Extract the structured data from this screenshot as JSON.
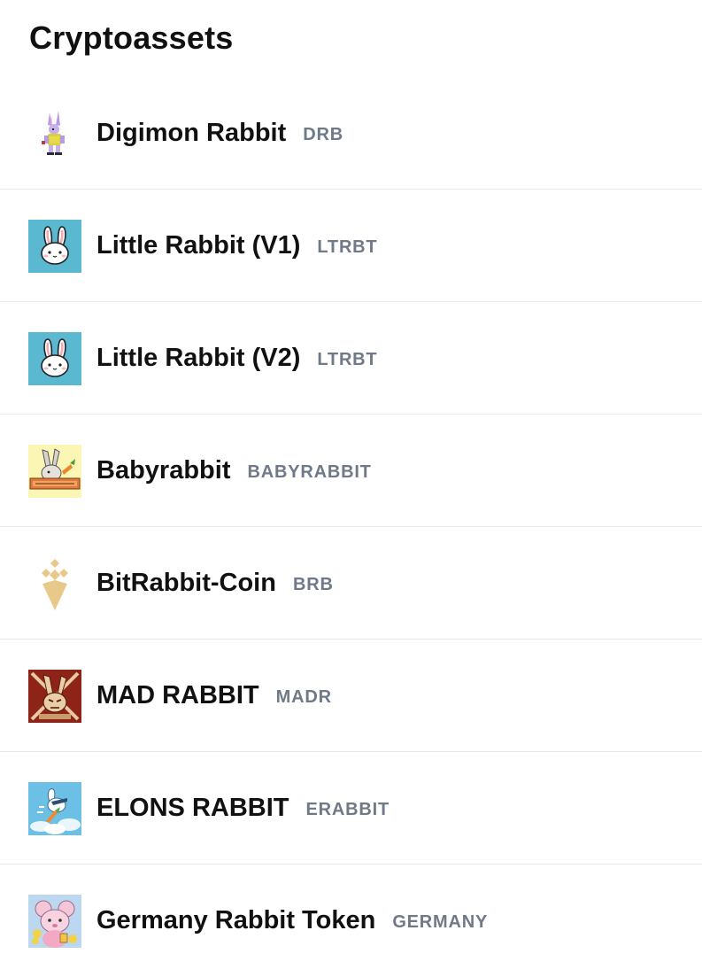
{
  "header": {
    "title": "Cryptoassets"
  },
  "assets": [
    {
      "name": "Digimon Rabbit",
      "ticker": "DRB",
      "icon": "digimon-rabbit-logo-icon"
    },
    {
      "name": "Little Rabbit (V1)",
      "ticker": "LTRBT",
      "icon": "little-rabbit-logo-icon"
    },
    {
      "name": "Little Rabbit (V2)",
      "ticker": "LTRBT",
      "icon": "little-rabbit-logo-icon"
    },
    {
      "name": "Babyrabbit",
      "ticker": "BABYRABBIT",
      "icon": "babyrabbit-logo-icon"
    },
    {
      "name": "BitRabbit-Coin",
      "ticker": "BRB",
      "icon": "bitrabbit-diamond-logo-icon"
    },
    {
      "name": "MAD RABBIT",
      "ticker": "MADR",
      "icon": "mad-rabbit-logo-icon"
    },
    {
      "name": "ELONS RABBIT",
      "ticker": "ERABBIT",
      "icon": "elons-rabbit-logo-icon"
    },
    {
      "name": "Germany Rabbit Token",
      "ticker": "GERMANY",
      "icon": "germany-rabbit-logo-icon"
    }
  ],
  "colors": {
    "ticker": "#6f7987",
    "divider": "#e7e8ea",
    "little_rabbit_bg": "#5ab8d1",
    "bitrabbit_gold": "#e8c98a",
    "mad_rabbit_bg": "#8e2418",
    "elons_rabbit_bg": "#6cc0e6"
  }
}
